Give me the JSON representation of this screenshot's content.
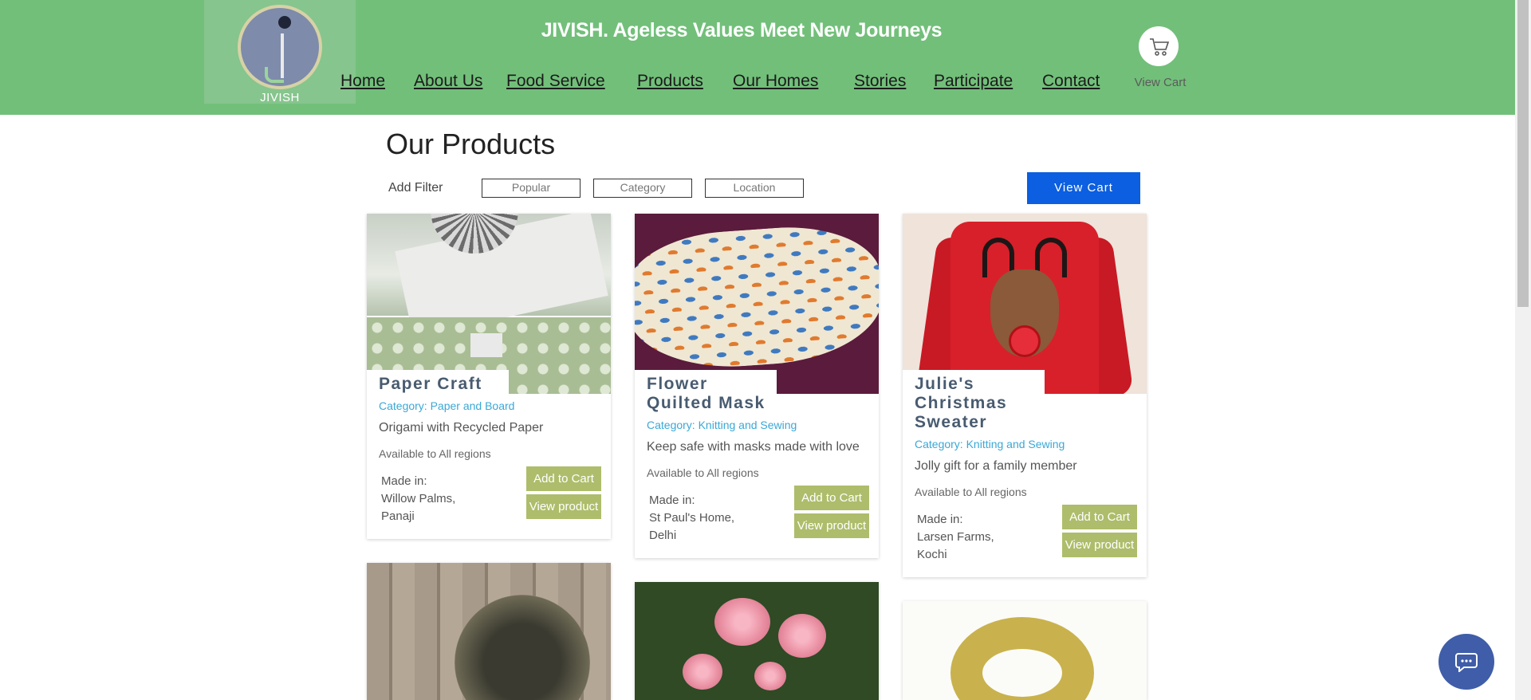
{
  "header": {
    "logo_text": "JIVISH",
    "site_title": "JIVISH. Ageless Values Meet New Journeys",
    "nav": [
      {
        "label": "Home"
      },
      {
        "label": "About Us"
      },
      {
        "label": "Food Service"
      },
      {
        "label": "Products"
      },
      {
        "label": "Our Homes"
      },
      {
        "label": "Stories"
      },
      {
        "label": "Participate"
      },
      {
        "label": "Contact"
      }
    ],
    "cart_label": "View Cart",
    "cart_icon": "cart-icon"
  },
  "main": {
    "title": "Our Products",
    "filter_label": "Add Filter",
    "filters": [
      {
        "label": "Popular"
      },
      {
        "label": "Category"
      },
      {
        "label": "Location"
      }
    ],
    "view_cart_button": "View Cart"
  },
  "products": [
    {
      "title": "Paper Craft",
      "category": "Category: Paper and Board",
      "description": "Origami with Recycled Paper",
      "availability": "Available to All regions",
      "made_label": "Made in:",
      "made_place": "Willow Palms,",
      "made_city": "Panaji",
      "add_to_cart": "Add to Cart",
      "view_product": "View product"
    },
    {
      "title": "Flower Quilted Mask",
      "category": "Category: Knitting and Sewing",
      "description": "Keep safe with masks made with love",
      "availability": "Available to All regions",
      "made_label": "Made in:",
      "made_place": "St Paul's Home,",
      "made_city": "Delhi",
      "add_to_cart": "Add to Cart",
      "view_product": "View product"
    },
    {
      "title": "Julie's Christmas Sweater",
      "category": "Category: Knitting and Sewing",
      "description": "Jolly gift for a family member",
      "availability": "Available to All regions",
      "made_label": "Made in:",
      "made_place": "Larsen Farms,",
      "made_city": "Kochi",
      "add_to_cart": "Add to Cart",
      "view_product": "View product"
    }
  ],
  "colors": {
    "header_bg": "#72bf7a",
    "accent_blue": "#0b5fe0",
    "button_olive": "#adbd6b",
    "category_text": "#3aa8d6",
    "chat_button": "#3f5da8"
  },
  "chat": {
    "icon": "chat-icon"
  }
}
